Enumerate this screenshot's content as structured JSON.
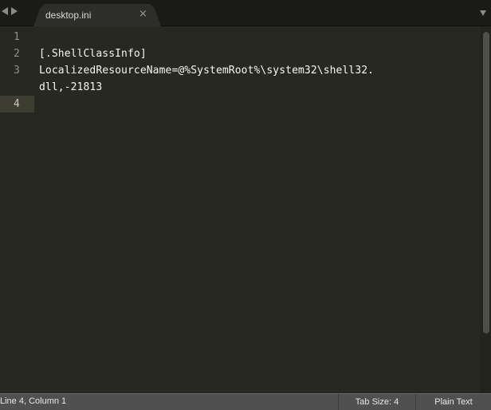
{
  "tabbar": {
    "tabs": [
      {
        "label": "desktop.ini",
        "active": true,
        "close_icon": "×"
      }
    ],
    "nav_left_icon": "chevron-left-icon",
    "nav_right_icon": "chevron-right-icon",
    "dropdown_icon": "chevron-down-icon"
  },
  "editor": {
    "current_line": 4,
    "lines": [
      {
        "number": "1",
        "text": ""
      },
      {
        "number": "2",
        "text": "[.ShellClassInfo]"
      },
      {
        "number": "3",
        "text": "LocalizedResourceName=@%SystemRoot%\\system32\\shell32."
      },
      {
        "number": "",
        "text": "dll,-21813"
      },
      {
        "number": "4",
        "text": ""
      }
    ]
  },
  "statusbar": {
    "position": "Line 4, Column 1",
    "tab_size": "Tab Size: 4",
    "syntax": "Plain Text"
  },
  "colors": {
    "editor_bg": "#272822",
    "current_line_bg": "#3e3d32",
    "text": "#f8f8f2",
    "line_number": "#8f908a",
    "statusbar_bg": "#505050"
  }
}
